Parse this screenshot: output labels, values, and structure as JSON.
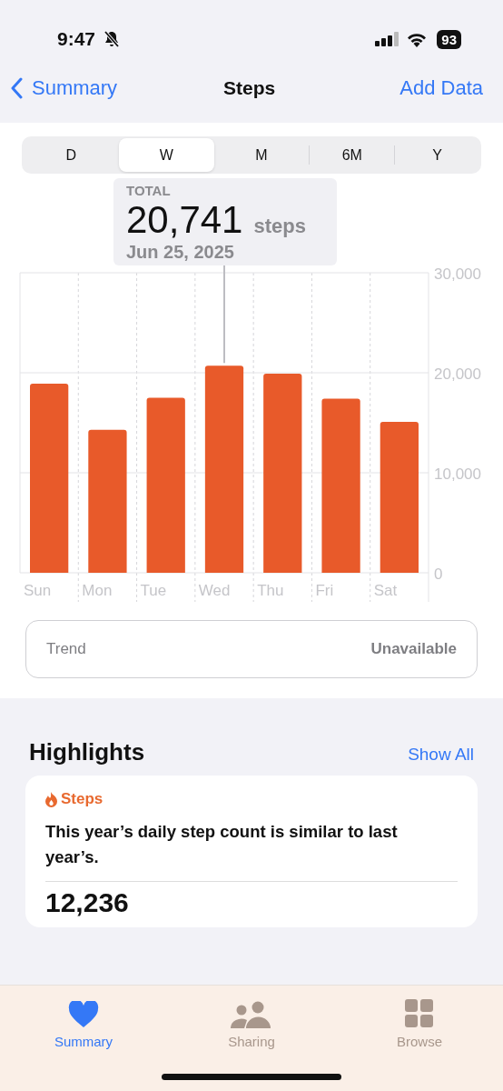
{
  "status_bar": {
    "time": "9:47",
    "battery": "93"
  },
  "nav": {
    "back": "Summary",
    "title": "Steps",
    "action": "Add Data"
  },
  "segments": [
    {
      "label": "D",
      "selected": false
    },
    {
      "label": "W",
      "selected": true
    },
    {
      "label": "M",
      "selected": false
    },
    {
      "label": "6M",
      "selected": false
    },
    {
      "label": "Y",
      "selected": false
    }
  ],
  "tooltip": {
    "label": "TOTAL",
    "value": "20,741",
    "unit": "steps",
    "date": "Jun 25, 2025"
  },
  "chart_data": {
    "type": "bar",
    "categories": [
      "Sun",
      "Mon",
      "Tue",
      "Wed",
      "Thu",
      "Fri",
      "Sat"
    ],
    "series": [
      {
        "color": "#e85a2a",
        "values": [
          18900,
          14300,
          17500,
          20700,
          19900,
          17400,
          15100
        ]
      }
    ],
    "ylim": [
      0,
      30000
    ],
    "yticks": [
      {
        "value": 0,
        "label": "0"
      },
      {
        "value": 10000,
        "label": "10,000"
      },
      {
        "value": 20000,
        "label": "20,000"
      },
      {
        "value": 30000,
        "label": "30,000"
      }
    ]
  },
  "trend": {
    "label": "Trend",
    "value": "Unavailable"
  },
  "highlights": {
    "title": "Highlights",
    "action": "Show All",
    "card": {
      "category": "Steps",
      "text": "This year’s daily step count is similar to last year’s.",
      "value": "12,236"
    }
  },
  "tab_bar": [
    {
      "label": "Summary",
      "kind": "heart",
      "selected": true
    },
    {
      "label": "Sharing",
      "kind": "people",
      "selected": false
    },
    {
      "label": "Browse",
      "kind": "grid",
      "selected": false
    }
  ]
}
